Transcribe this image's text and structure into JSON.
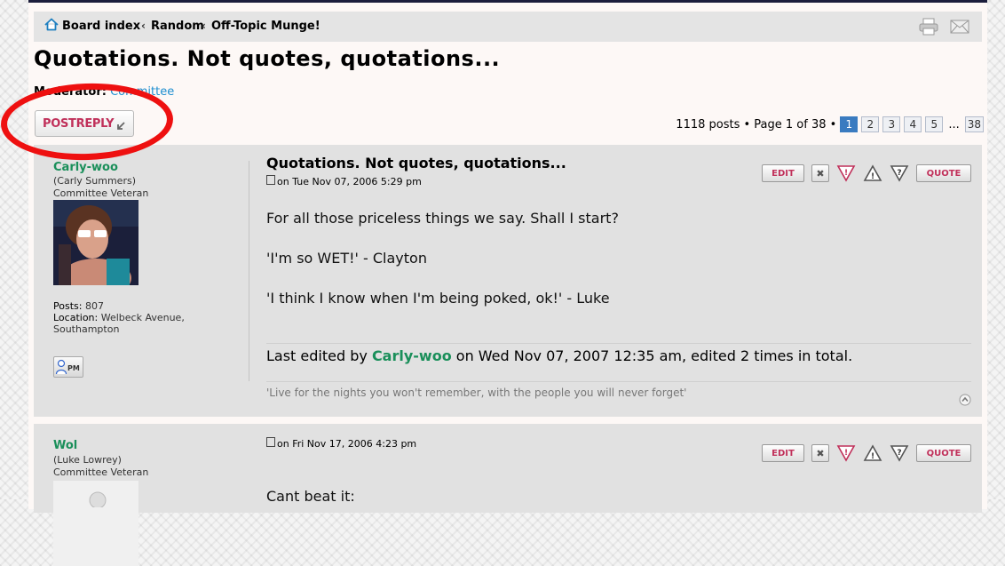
{
  "breadcrumb": {
    "items": [
      "Board index",
      "Random",
      "Off-Topic Munge!"
    ],
    "separator": "‹"
  },
  "topic": {
    "title": "Quotations. Not quotes, quotations...",
    "moderator_label": "Moderator:",
    "moderator_name": "Committee"
  },
  "buttons": {
    "post_reply": "POSTREPLY",
    "edit": "EDIT",
    "quote": "QUOTE",
    "pm": "PM"
  },
  "pagination": {
    "summary": "1118 posts • Page 1 of 38 •",
    "pages": [
      "1",
      "2",
      "3",
      "4",
      "5"
    ],
    "current": "1",
    "ellipsis": "...",
    "last": "38"
  },
  "posts": [
    {
      "username": "Carly-woo",
      "realname": "(Carly Summers)",
      "rank": "Committee Veteran",
      "posts_label": "Posts:",
      "posts_count": "807",
      "location_label": "Location:",
      "location_line1": "Welbeck Avenue,",
      "location_line2": "Southampton",
      "subject": "Quotations. Not quotes, quotations...",
      "date": "on Tue Nov 07, 2006 5:29 pm",
      "lines": [
        "For all those priceless things we say. Shall I start?",
        "'I'm so WET!' - Clayton",
        "'I think I know when I'm being poked, ok!' - Luke"
      ],
      "edited_prefix": "Last edited by",
      "edited_by": "Carly-woo",
      "edited_suffix": "on Wed Nov 07, 2007 12:35 am, edited 2 times in total.",
      "signature": "'Live for the nights you won't remember, with the people you will never forget'"
    },
    {
      "username": "Wol",
      "realname": "(Luke Lowrey)",
      "rank": "Committee Veteran",
      "date": "on Fri Nov 17, 2006 4:23 pm",
      "lines": [
        "Cant beat it:"
      ]
    }
  ],
  "colors": {
    "username": "#1a8f5a",
    "button_text": "#c0305a",
    "link": "#1f8fd0",
    "annotation_circle": "#ee1010"
  }
}
